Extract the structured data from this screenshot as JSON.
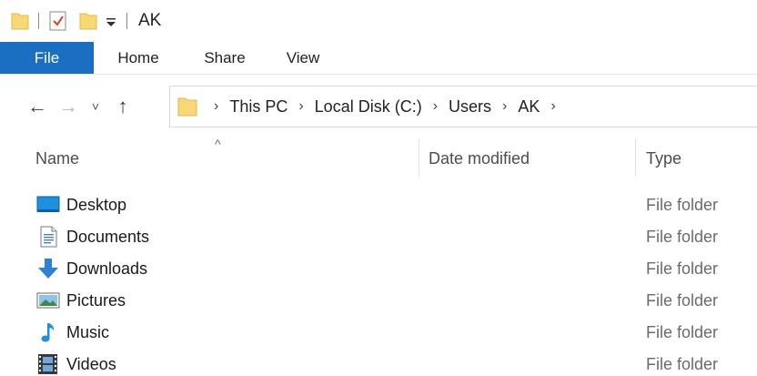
{
  "titlebar": {
    "title": "AK",
    "icons": [
      "folder-icon",
      "properties-icon",
      "new-folder-icon",
      "customize-dropdown-icon"
    ]
  },
  "ribbon": {
    "tabs": [
      {
        "label": "File",
        "active": true
      },
      {
        "label": "Home"
      },
      {
        "label": "Share"
      },
      {
        "label": "View"
      }
    ],
    "accent_color": "#1a6fc2"
  },
  "navigation": {
    "back_glyph": "←",
    "forward_glyph": "→",
    "recent_glyph": "˅",
    "up_glyph": "↑",
    "breadcrumb_separator": "›",
    "breadcrumb": [
      "This PC",
      "Local Disk (C:)",
      "Users",
      "AK"
    ]
  },
  "columns": {
    "sort_indicator": "^",
    "name": "Name",
    "date_modified": "Date modified",
    "type": "Type"
  },
  "files": [
    {
      "name": "Desktop",
      "type": "File folder",
      "icon": "desktop-icon"
    },
    {
      "name": "Documents",
      "type": "File folder",
      "icon": "documents-icon"
    },
    {
      "name": "Downloads",
      "type": "File folder",
      "icon": "downloads-icon"
    },
    {
      "name": "Pictures",
      "type": "File folder",
      "icon": "pictures-icon"
    },
    {
      "name": "Music",
      "type": "File folder",
      "icon": "music-icon"
    },
    {
      "name": "Videos",
      "type": "File folder",
      "icon": "videos-icon"
    }
  ]
}
